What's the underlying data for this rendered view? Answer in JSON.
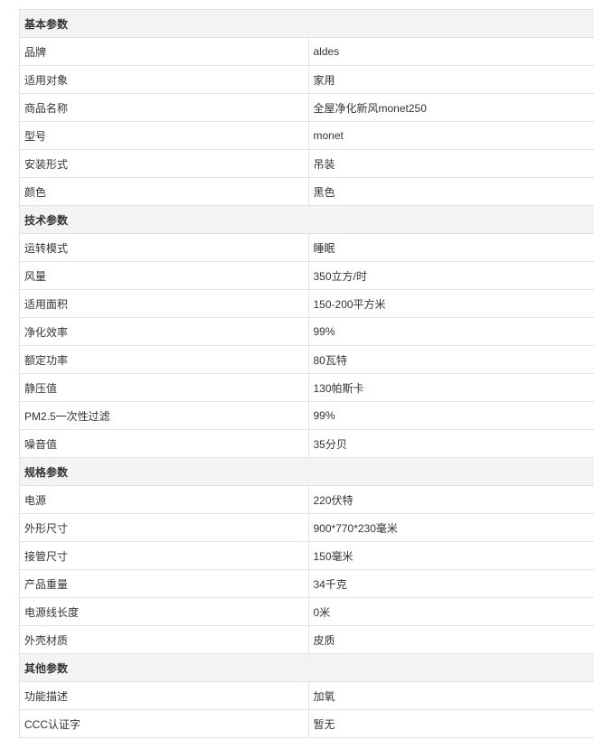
{
  "spec_table": {
    "sections": [
      {
        "title": "基本参数",
        "rows": [
          {
            "key": "品牌",
            "value": "aldes"
          },
          {
            "key": "适用对象",
            "value": "家用"
          },
          {
            "key": "商品名称",
            "value": "全屋净化新风monet250"
          },
          {
            "key": "型号",
            "value": "monet"
          },
          {
            "key": "安装形式",
            "value": "吊装"
          },
          {
            "key": "颜色",
            "value": "黑色"
          }
        ]
      },
      {
        "title": "技术参数",
        "rows": [
          {
            "key": "运转模式",
            "value": "睡眠"
          },
          {
            "key": "风量",
            "value": "350立方/时"
          },
          {
            "key": "适用面积",
            "value": "150-200平方米"
          },
          {
            "key": "净化效率",
            "value": "99%"
          },
          {
            "key": "额定功率",
            "value": "80瓦特"
          },
          {
            "key": "静压值",
            "value": "130帕斯卡"
          },
          {
            "key": "PM2.5一次性过滤",
            "value": "99%"
          },
          {
            "key": "噪音值",
            "value": "35分贝"
          }
        ]
      },
      {
        "title": "规格参数",
        "rows": [
          {
            "key": "电源",
            "value": "220伏特"
          },
          {
            "key": "外形尺寸",
            "value": "900*770*230毫米"
          },
          {
            "key": "接管尺寸",
            "value": "150毫米"
          },
          {
            "key": "产品重量",
            "value": "34千克"
          },
          {
            "key": "电源线长度",
            "value": "0米"
          },
          {
            "key": "外壳材质",
            "value": "皮质"
          }
        ]
      },
      {
        "title": "其他参数",
        "rows": [
          {
            "key": "功能描述",
            "value": "加氧"
          },
          {
            "key": "CCC认证字",
            "value": "暂无"
          }
        ]
      }
    ]
  }
}
